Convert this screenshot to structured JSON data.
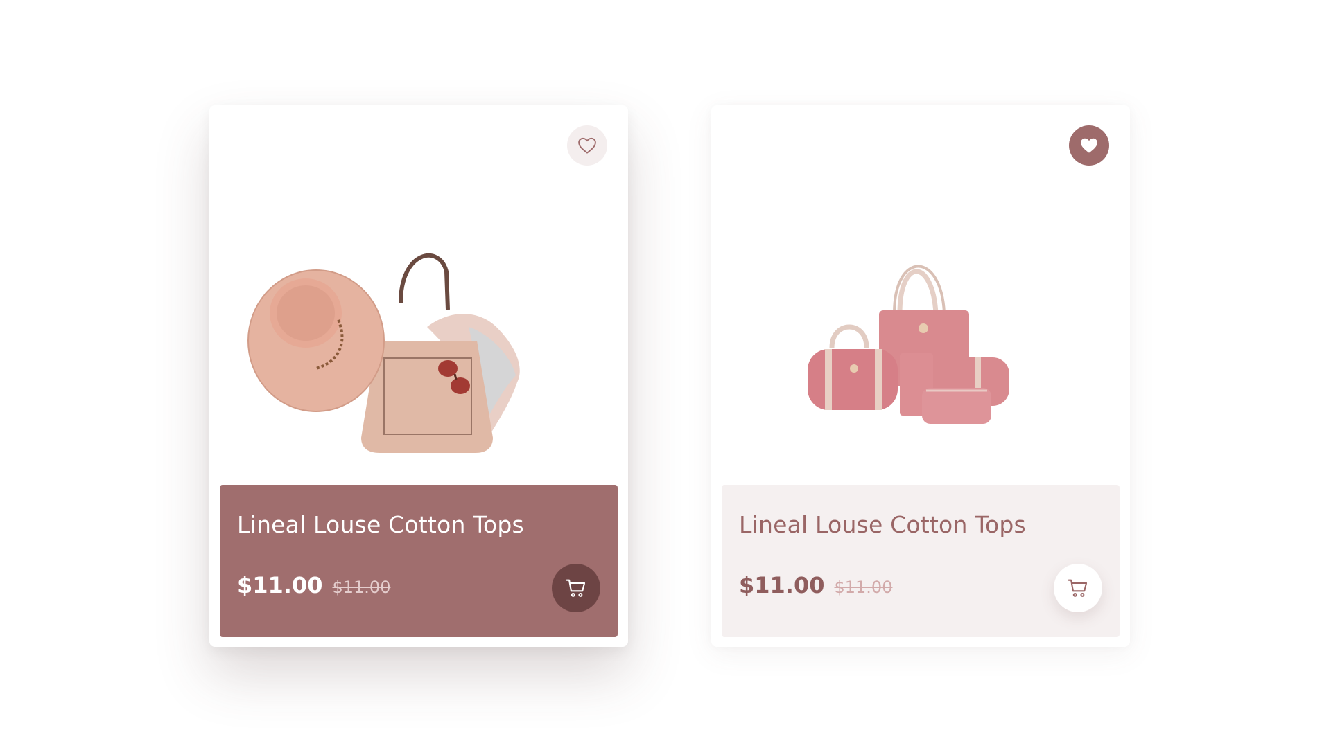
{
  "products": [
    {
      "title": "Lineal Louse Cotton Tops",
      "price": "$11.00",
      "old_price": "$11.00",
      "favorite": false,
      "favorite_icon": "heart-outline-icon",
      "cart_icon": "shopping-cart-icon",
      "image": "hat-bag-scarf-image"
    },
    {
      "title": "Lineal Louse Cotton Tops",
      "price": "$11.00",
      "old_price": "$11.00",
      "favorite": true,
      "favorite_icon": "heart-filled-icon",
      "cart_icon": "shopping-cart-icon",
      "image": "pink-handbag-set-image"
    }
  ],
  "colors": {
    "accent": "#a06e6e",
    "accent_dark": "#6d4444",
    "light_panel": "#f5f0f0",
    "fav_filled": "#9e6b6b",
    "fav_outline_bg": "#f4eeee"
  }
}
